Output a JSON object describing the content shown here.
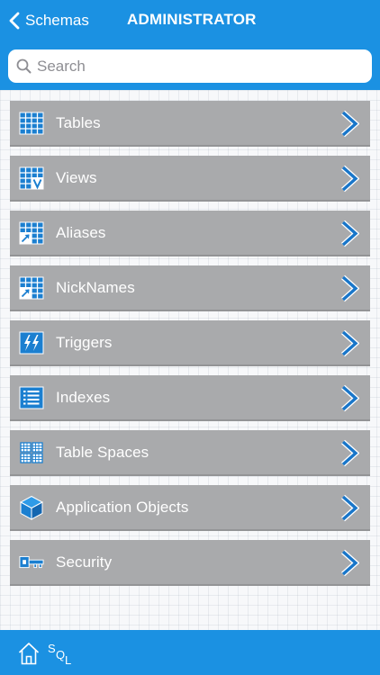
{
  "header": {
    "back_label": "Schemas",
    "title": "ADMINISTRATOR",
    "search_placeholder": "Search"
  },
  "list": {
    "items": [
      {
        "label": "Tables",
        "icon": "table-grid-icon"
      },
      {
        "label": "Views",
        "icon": "view-grid-icon"
      },
      {
        "label": "Aliases",
        "icon": "alias-grid-icon"
      },
      {
        "label": "NickNames",
        "icon": "nickname-grid-icon"
      },
      {
        "label": "Triggers",
        "icon": "lightning-bolt-icon"
      },
      {
        "label": "Indexes",
        "icon": "index-list-icon"
      },
      {
        "label": "Table Spaces",
        "icon": "tablespace-grid-icon"
      },
      {
        "label": "Application Objects",
        "icon": "cube-icon"
      },
      {
        "label": "Security",
        "icon": "key-icon"
      }
    ]
  },
  "footer": {
    "sql_letters": [
      "S",
      "Q",
      "L"
    ]
  },
  "colors": {
    "brand_blue": "#1b91e2",
    "row_gray": "#a9aaac",
    "icon_blue": "#1b7fd0",
    "chevron_blue": "#1976c9"
  }
}
